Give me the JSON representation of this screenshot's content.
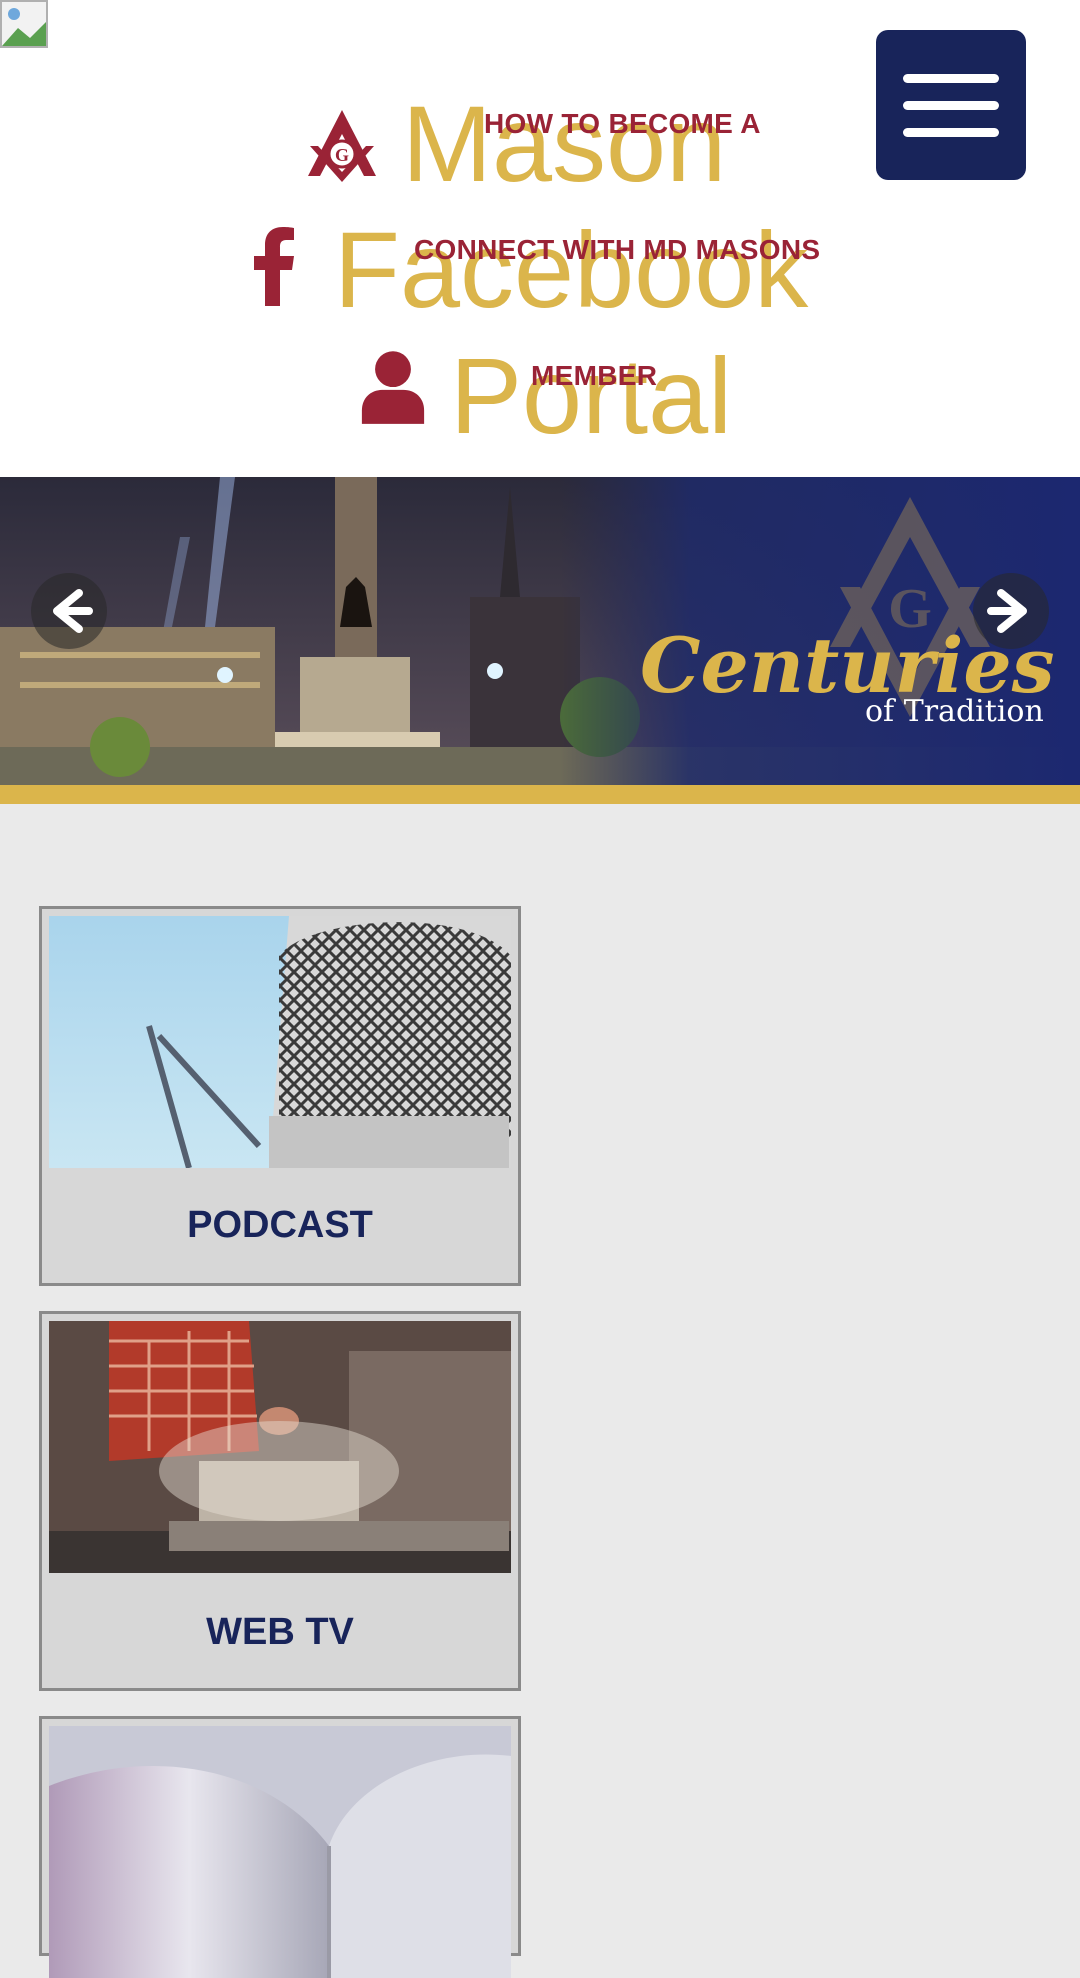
{
  "header": {
    "menu_button_label": "",
    "nav": [
      {
        "big": "Mason",
        "label": "HOW TO BECOME A",
        "icon": "square-compass-icon"
      },
      {
        "big": "Facebook",
        "label": "CONNECT WITH MD MASONS",
        "icon": "facebook-icon"
      },
      {
        "big": "Portal",
        "label": "MEMBER",
        "icon": "user-icon"
      }
    ]
  },
  "banner": {
    "script_text": "Centuries",
    "sub_text": "of Tradition"
  },
  "cards": [
    {
      "label": "PODCAST"
    },
    {
      "label": "WEB TV"
    },
    {
      "label": ""
    }
  ],
  "colors": {
    "navy": "#18245a",
    "gold": "#dbb54b",
    "maroon": "#9a2336"
  }
}
